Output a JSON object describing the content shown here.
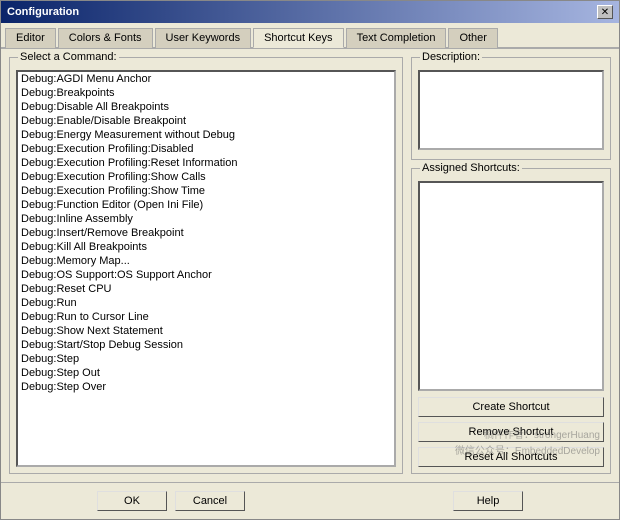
{
  "window": {
    "title": "Configuration",
    "close_label": "✕"
  },
  "tabs": [
    {
      "id": "editor",
      "label": "Editor"
    },
    {
      "id": "colors-fonts",
      "label": "Colors & Fonts"
    },
    {
      "id": "user-keywords",
      "label": "User Keywords"
    },
    {
      "id": "shortcut-keys",
      "label": "Shortcut Keys",
      "active": true
    },
    {
      "id": "text-completion",
      "label": "Text Completion"
    },
    {
      "id": "other",
      "label": "Other"
    }
  ],
  "left_panel": {
    "group_label": "Select a Command:",
    "items": [
      "Debug:AGDI Menu Anchor",
      "Debug:Breakpoints",
      "Debug:Disable All Breakpoints",
      "Debug:Enable/Disable Breakpoint",
      "Debug:Energy Measurement without Debug",
      "Debug:Execution Profiling:Disabled",
      "Debug:Execution Profiling:Reset Information",
      "Debug:Execution Profiling:Show Calls",
      "Debug:Execution Profiling:Show Time",
      "Debug:Function Editor (Open Ini File)",
      "Debug:Inline Assembly",
      "Debug:Insert/Remove Breakpoint",
      "Debug:Kill All Breakpoints",
      "Debug:Memory Map...",
      "Debug:OS Support:OS Support Anchor",
      "Debug:Reset CPU",
      "Debug:Run",
      "Debug:Run to Cursor Line",
      "Debug:Show Next Statement",
      "Debug:Start/Stop Debug Session",
      "Debug:Step",
      "Debug:Step Out",
      "Debug:Step Over"
    ]
  },
  "right_panel": {
    "description_label": "Description:",
    "shortcuts_label": "Assigned Shortcuts:",
    "buttons": {
      "create": "Create Shortcut",
      "remove": "Remove Shortcut",
      "reset": "Reset All Shortcuts"
    }
  },
  "footer": {
    "ok": "OK",
    "cancel": "Cancel",
    "help": "Help"
  },
  "watermark": {
    "line1": "稿件作者：strongerHuang",
    "line2": "微信公众号：EmbeddedDevelop"
  }
}
